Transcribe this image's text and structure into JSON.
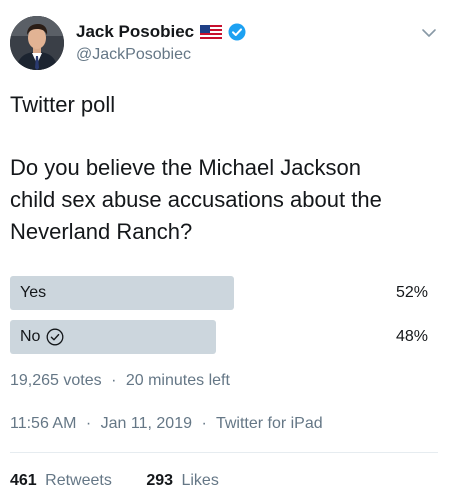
{
  "header": {
    "display_name": "Jack Posobiec",
    "handle": "@JackPosobiec",
    "flag_icon": "us-flag-icon",
    "verified_icon": "verified-badge-icon",
    "menu_icon": "chevron-down-icon",
    "verified_color": "#1da1f2"
  },
  "tweet": {
    "lines": [
      "Twitter poll",
      "Do you believe the Michael Jackson",
      "child sex abuse accusations about the",
      "Neverland Ranch?"
    ]
  },
  "poll": {
    "options": [
      {
        "label": "Yes",
        "percent_text": "52%",
        "fraction": 0.52,
        "selected": false
      },
      {
        "label": "No",
        "percent_text": "48%",
        "fraction": 0.48,
        "selected": true
      }
    ],
    "votes_text": "19,265 votes",
    "time_left_text": "20 minutes left",
    "bar_color": "#ccd6dd"
  },
  "meta": {
    "time": "11:56 AM",
    "date": "Jan 11, 2019",
    "source": "Twitter for iPad",
    "separator": "·"
  },
  "stats": {
    "retweets_count": "461",
    "retweets_label": "Retweets",
    "likes_count": "293",
    "likes_label": "Likes"
  }
}
